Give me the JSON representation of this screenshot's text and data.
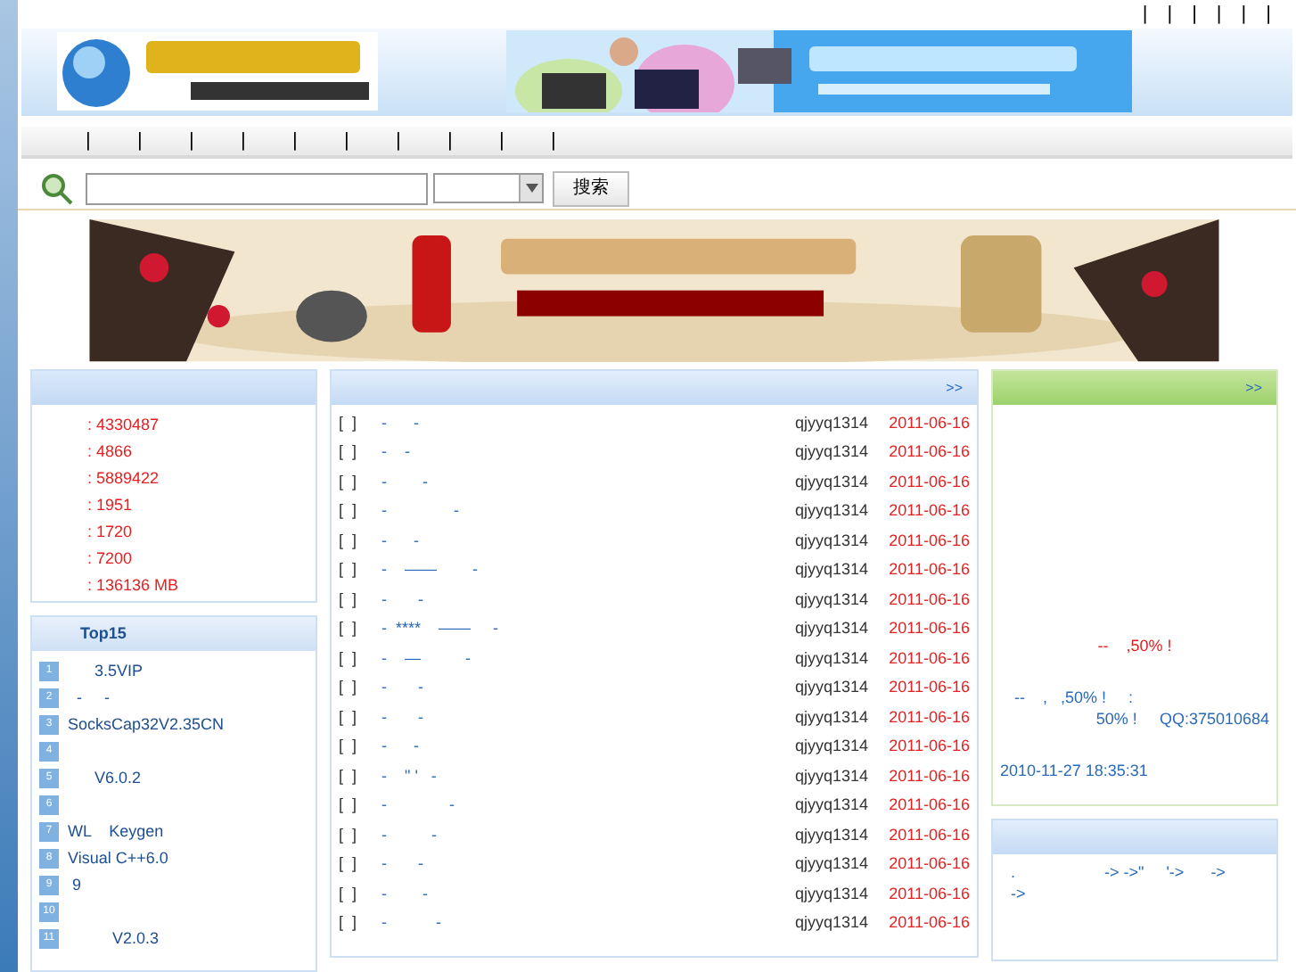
{
  "top_bar": {
    "separators": [
      "|",
      "|",
      "|",
      "|",
      "|",
      "|"
    ]
  },
  "nav": {
    "separators": [
      "|",
      "|",
      "|",
      "|",
      "|",
      "|",
      "|",
      "|",
      "|",
      "|"
    ]
  },
  "search": {
    "button": "搜索"
  },
  "stats_panel": {
    "rows": [
      ": 4330487",
      ": 4866",
      ": 5889422",
      ": 1951",
      ": 1720",
      ": 7200",
      ": 136136 MB"
    ]
  },
  "top_panel": {
    "title": "Top15",
    "items": [
      {
        "rank": "1",
        "title": "      3.5VIP"
      },
      {
        "rank": "2",
        "title": "  -     -"
      },
      {
        "rank": "3",
        "title": "SocksCap32V2.35CN"
      },
      {
        "rank": "4"
      },
      {
        "rank": "5",
        "title": "      V6.0.2"
      },
      {
        "rank": "6"
      },
      {
        "rank": "7",
        "title": "WL    Keygen"
      },
      {
        "rank": "8",
        "title": "Visual C++6.0"
      },
      {
        "rank": "9",
        "title": " 9"
      },
      {
        "rank": "10"
      },
      {
        "rank": "11",
        "title": "          V2.0.3"
      }
    ]
  },
  "list_panel": {
    "more": ">>",
    "rows": [
      {
        "bracket": "[  ]",
        "title": "-      -",
        "author": "qjyyq1314",
        "date": "2011-06-16"
      },
      {
        "bracket": "[  ]",
        "title": "-    -",
        "author": "qjyyq1314",
        "date": "2011-06-16"
      },
      {
        "bracket": "[  ]",
        "title": "-        -",
        "author": "qjyyq1314",
        "date": "2011-06-16"
      },
      {
        "bracket": "[  ]",
        "title": "-               -",
        "author": "qjyyq1314",
        "date": "2011-06-16"
      },
      {
        "bracket": "[  ]",
        "title": "-      -",
        "author": "qjyyq1314",
        "date": "2011-06-16"
      },
      {
        "bracket": "[  ]",
        "title": "-    ——        -",
        "author": "qjyyq1314",
        "date": "2011-06-16"
      },
      {
        "bracket": "[  ]",
        "title": "-       -",
        "author": "qjyyq1314",
        "date": "2011-06-16"
      },
      {
        "bracket": "[  ]",
        "title": "-  ****    ——     -",
        "author": "qjyyq1314",
        "date": "2011-06-16"
      },
      {
        "bracket": "[  ]",
        "title": "-    —          -",
        "author": "qjyyq1314",
        "date": "2011-06-16"
      },
      {
        "bracket": "[  ]",
        "title": "-       -",
        "author": "qjyyq1314",
        "date": "2011-06-16"
      },
      {
        "bracket": "[  ]",
        "title": "-       -",
        "author": "qjyyq1314",
        "date": "2011-06-16"
      },
      {
        "bracket": "[  ]",
        "title": "-      -",
        "author": "qjyyq1314",
        "date": "2011-06-16"
      },
      {
        "bracket": "[  ]",
        "title": "-    \" '   -",
        "author": "qjyyq1314",
        "date": "2011-06-16"
      },
      {
        "bracket": "[  ]",
        "title": "-              -",
        "author": "qjyyq1314",
        "date": "2011-06-16"
      },
      {
        "bracket": "[  ]",
        "title": "-          -",
        "author": "qjyyq1314",
        "date": "2011-06-16"
      },
      {
        "bracket": "[  ]",
        "title": "-       -",
        "author": "qjyyq1314",
        "date": "2011-06-16"
      },
      {
        "bracket": "[  ]",
        "title": "-        -",
        "author": "qjyyq1314",
        "date": "2011-06-16"
      },
      {
        "bracket": "[  ]",
        "title": "-           -",
        "author": "qjyyq1314",
        "date": "2011-06-16"
      }
    ]
  },
  "notice_panel": {
    "more": ">>",
    "headline": "--    ,50% !",
    "body_lines": [
      "--    ,   ,50% !     :",
      "50% !     QQ:375010684"
    ],
    "time": "2010-11-27 18:35:31"
  },
  "links_panel": {
    "lines": [
      ".                    -> ->\"     '->      ->",
      "->"
    ]
  }
}
